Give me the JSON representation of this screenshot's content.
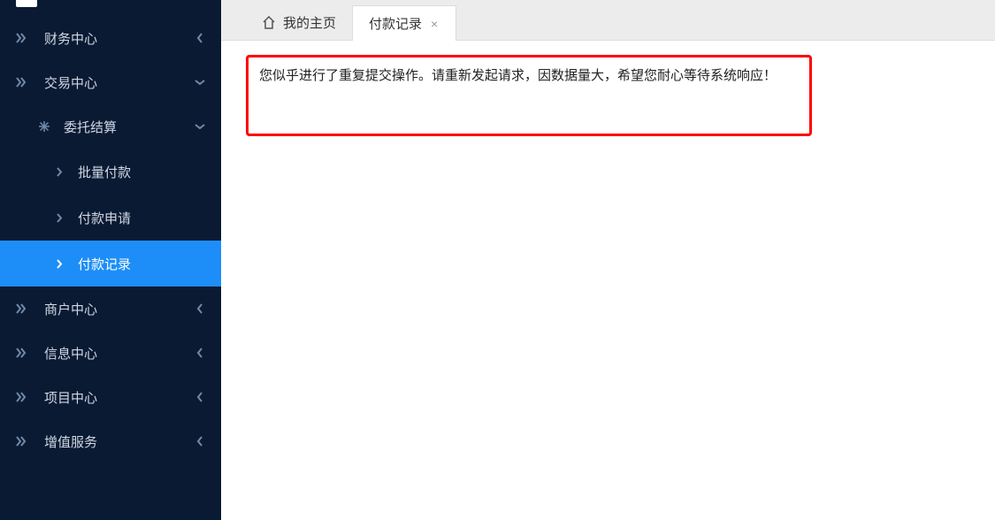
{
  "sidebar": {
    "items": [
      {
        "label": "财务中心",
        "expanded": false
      },
      {
        "label": "交易中心",
        "expanded": true,
        "children": [
          {
            "label": "委托结算",
            "expanded": true,
            "leaves": [
              {
                "label": "批量付款",
                "active": false
              },
              {
                "label": "付款申请",
                "active": false
              },
              {
                "label": "付款记录",
                "active": true
              }
            ]
          }
        ]
      },
      {
        "label": "商户中心",
        "expanded": false
      },
      {
        "label": "信息中心",
        "expanded": false
      },
      {
        "label": "项目中心",
        "expanded": false
      },
      {
        "label": "增值服务",
        "expanded": false
      }
    ]
  },
  "tabs": {
    "home_label": "我的主页",
    "active_label": "付款记录",
    "close_glyph": "×"
  },
  "message": {
    "text": "您似乎进行了重复提交操作。请重新发起请求，因数据量大，希望您耐心等待系统响应！"
  }
}
